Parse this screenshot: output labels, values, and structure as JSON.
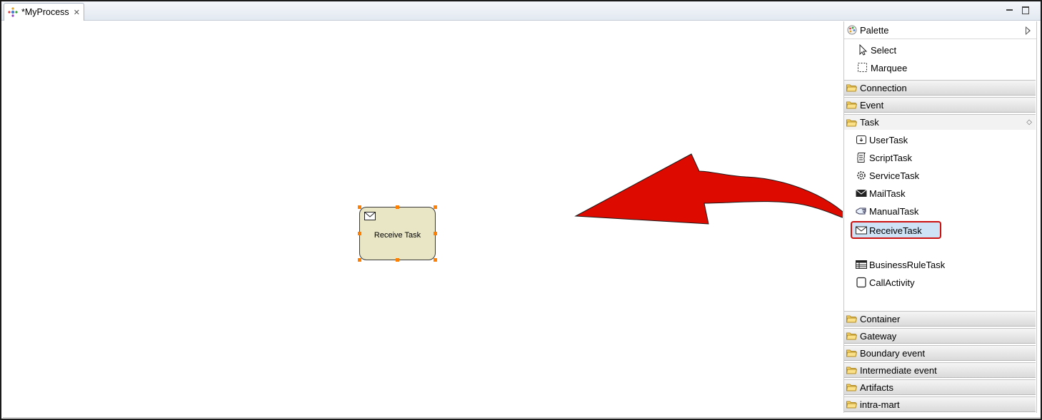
{
  "editor": {
    "tab_title": "*MyProcess",
    "tab_icon": "process-icon"
  },
  "canvas": {
    "node": {
      "label": "Receive Task",
      "icon": "mail-icon",
      "fill_color": "#e8e6c4",
      "handle_color": "#ff7f00"
    },
    "annotation_arrow_color": "#dd0a00"
  },
  "palette": {
    "title": "Palette",
    "tools": [
      {
        "label": "Select",
        "icon": "pointer-icon"
      },
      {
        "label": "Marquee",
        "icon": "marquee-icon"
      }
    ],
    "drawers_top": [
      {
        "label": "Connection"
      },
      {
        "label": "Event"
      }
    ],
    "open_drawer": {
      "label": "Task",
      "items": [
        {
          "label": "UserTask",
          "icon": "user-task-icon"
        },
        {
          "label": "ScriptTask",
          "icon": "script-task-icon"
        },
        {
          "label": "ServiceTask",
          "icon": "gear-icon"
        },
        {
          "label": "MailTask",
          "icon": "mail-filled-icon"
        },
        {
          "label": "ManualTask",
          "icon": "hand-icon"
        },
        {
          "label": "ReceiveTask",
          "icon": "mail-icon"
        },
        {
          "label": "BusinessRuleTask",
          "icon": "table-icon"
        },
        {
          "label": "CallActivity",
          "icon": "box-icon"
        }
      ],
      "selected": "ReceiveTask"
    },
    "drawers_bottom": [
      {
        "label": "Container"
      },
      {
        "label": "Gateway"
      },
      {
        "label": "Boundary event"
      },
      {
        "label": "Intermediate event"
      },
      {
        "label": "Artifacts"
      },
      {
        "label": "intra-mart"
      }
    ],
    "highlight_color": "#cc1111"
  }
}
